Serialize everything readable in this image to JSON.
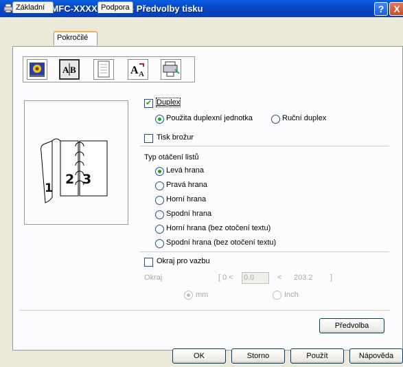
{
  "window": {
    "title": "Brother MFC-XXXX Printer - Předvolby tisku",
    "help_symbol": "?",
    "close_symbol": "X"
  },
  "tabs": [
    {
      "label": "Základní"
    },
    {
      "label": "Pokročilé"
    },
    {
      "label": "Podpora"
    }
  ],
  "toolbar_icons": [
    "quality-icon",
    "duplex-icon",
    "watermark-icon",
    "page-setting-icon",
    "device-options-icon"
  ],
  "preview": {
    "digits": [
      "1",
      "2",
      "3"
    ]
  },
  "duplex": {
    "label": "Duplex",
    "checked": true,
    "options": [
      {
        "label": "Použita duplexní jednotka",
        "selected": true
      },
      {
        "label": "Ruční duplex",
        "selected": false
      }
    ]
  },
  "booklet": {
    "label": "Tisk brožur",
    "checked": false
  },
  "flip": {
    "heading": "Typ otáčení listů",
    "options": [
      {
        "label": "Levá hrana",
        "selected": true
      },
      {
        "label": "Pravá hrana",
        "selected": false
      },
      {
        "label": "Horní hrana",
        "selected": false
      },
      {
        "label": "Spodní hrana",
        "selected": false
      },
      {
        "label": "Horní hrana (bez otočení textu)",
        "selected": false
      },
      {
        "label": "Spodní hrana (bez otočení textu)",
        "selected": false
      }
    ]
  },
  "binding": {
    "label": "Okraj pro vazbu",
    "checked": false,
    "margin_label": "Okraj",
    "range_open": "[ 0 <",
    "value": "0.0",
    "range_mid": "<",
    "range_max": "203.2",
    "range_close": "]",
    "units": [
      {
        "label": "mm",
        "selected": true
      },
      {
        "label": "Inch",
        "selected": false
      }
    ]
  },
  "buttons": {
    "default": "Předvolba",
    "ok": "OK",
    "cancel": "Storno",
    "apply": "Použít",
    "help": "Nápověda"
  },
  "colors": {
    "title_blue": "#0649c8",
    "check_green": "#21a121",
    "tab_accent": "#f8b048"
  }
}
